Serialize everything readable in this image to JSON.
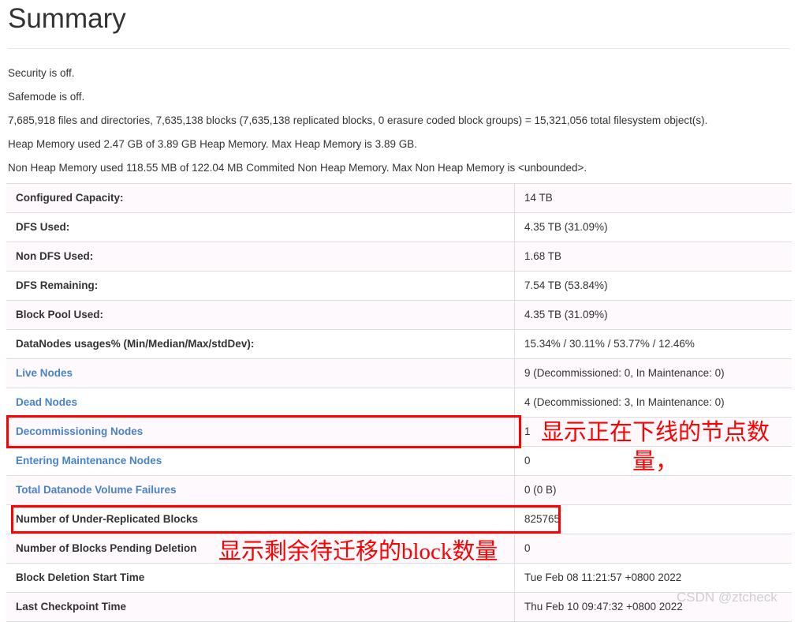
{
  "header": {
    "title": "Summary"
  },
  "intro": {
    "lines": [
      "Security is off.",
      "Safemode is off.",
      "7,685,918 files and directories, 7,635,138 blocks (7,635,138 replicated blocks, 0 erasure coded block groups) = 15,321,056 total filesystem object(s).",
      "Heap Memory used 2.47 GB of 3.89 GB Heap Memory. Max Heap Memory is 3.89 GB.",
      "Non Heap Memory used 118.55 MB of 122.04 MB Commited Non Heap Memory. Max Non Heap Memory is <unbounded>."
    ]
  },
  "summary_table": {
    "rows": [
      {
        "key": "Configured Capacity:",
        "value": "14 TB",
        "is_link": false
      },
      {
        "key": "DFS Used:",
        "value": "4.35 TB (31.09%)",
        "is_link": false
      },
      {
        "key": "Non DFS Used:",
        "value": "1.68 TB",
        "is_link": false
      },
      {
        "key": "DFS Remaining:",
        "value": "7.54 TB (53.84%)",
        "is_link": false
      },
      {
        "key": "Block Pool Used:",
        "value": "4.35 TB (31.09%)",
        "is_link": false
      },
      {
        "key": "DataNodes usages% (Min/Median/Max/stdDev):",
        "value": "15.34% / 30.11% / 53.77% / 12.46%",
        "is_link": false
      },
      {
        "key": "Live Nodes",
        "value": "9 (Decommissioned: 0, In Maintenance: 0)",
        "is_link": true
      },
      {
        "key": "Dead Nodes",
        "value": "4 (Decommissioned: 3, In Maintenance: 0)",
        "is_link": true
      },
      {
        "key": "Decommissioning Nodes",
        "value": "1",
        "is_link": true
      },
      {
        "key": "Entering Maintenance Nodes",
        "value": "0",
        "is_link": true
      },
      {
        "key": "Total Datanode Volume Failures",
        "value": "0 (0 B)",
        "is_link": true
      },
      {
        "key": "Number of Under-Replicated Blocks",
        "value": "825765",
        "is_link": false
      },
      {
        "key": "Number of Blocks Pending Deletion",
        "value": "0",
        "is_link": false
      },
      {
        "key": "Block Deletion Start Time",
        "value": "Tue Feb 08 11:21:57 +0800 2022",
        "is_link": false
      },
      {
        "key": "Last Checkpoint Time",
        "value": "Thu Feb 10 09:47:32 +0800 2022",
        "is_link": false
      }
    ]
  },
  "annotations": {
    "color": "#ff0000",
    "decommissioning_note": "显示正在下线的节点数量，",
    "pending_deletion_note": "显示剩余待迁移的block数量"
  },
  "watermark": {
    "text": "CSDN @ztcheck",
    "color": "#cfcfcf"
  },
  "theme": {
    "link_color": "#4a82c8",
    "row_tint": "#fdf9fd",
    "border_color": "#dddddd"
  }
}
